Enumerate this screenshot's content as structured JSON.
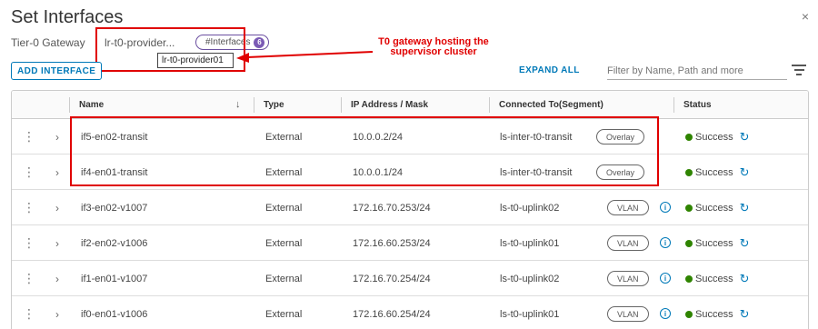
{
  "dialog": {
    "title": "Set Interfaces",
    "close_glyph": "×"
  },
  "gateway": {
    "label": "Tier-0 Gateway",
    "value": "lr-t0-provider...",
    "interfaces_label": "#Interfaces",
    "interfaces_count": "6",
    "tooltip": "lr-t0-provider01"
  },
  "annotation": {
    "text": "T0 gateway hosting the supervisor cluster",
    "color": "#e00000"
  },
  "toolbar": {
    "add_label": "ADD INTERFACE",
    "expand_label": "EXPAND ALL",
    "filter_placeholder": "Filter by Name, Path and more",
    "filter_icon": "filter-lines-icon"
  },
  "table": {
    "columns": [
      "Name",
      "Type",
      "IP Address / Mask",
      "Connected To(Segment)",
      "Status"
    ],
    "sort_glyph": "↓",
    "rows": [
      {
        "name": "if5-en02-transit",
        "type": "External",
        "ip": "10.0.0.2/24",
        "segment": "ls-inter-t0-transit",
        "segment_type": "Overlay",
        "info": false,
        "status": "Success"
      },
      {
        "name": "if4-en01-transit",
        "type": "External",
        "ip": "10.0.0.1/24",
        "segment": "ls-inter-t0-transit",
        "segment_type": "Overlay",
        "info": false,
        "status": "Success"
      },
      {
        "name": "if3-en02-v1007",
        "type": "External",
        "ip": "172.16.70.253/24",
        "segment": "ls-t0-uplink02",
        "segment_type": "VLAN",
        "info": true,
        "status": "Success"
      },
      {
        "name": "if2-en02-v1006",
        "type": "External",
        "ip": "172.16.60.253/24",
        "segment": "ls-t0-uplink01",
        "segment_type": "VLAN",
        "info": true,
        "status": "Success"
      },
      {
        "name": "if1-en01-v1007",
        "type": "External",
        "ip": "172.16.70.254/24",
        "segment": "ls-t0-uplink02",
        "segment_type": "VLAN",
        "info": true,
        "status": "Success"
      },
      {
        "name": "if0-en01-v1006",
        "type": "External",
        "ip": "172.16.60.254/24",
        "segment": "ls-t0-uplink01",
        "segment_type": "VLAN",
        "info": true,
        "status": "Success"
      }
    ]
  },
  "colors": {
    "accent": "#0079b8",
    "success": "#2f8400",
    "highlight": "#e00000",
    "badge_purple": "#7b5ab5"
  }
}
